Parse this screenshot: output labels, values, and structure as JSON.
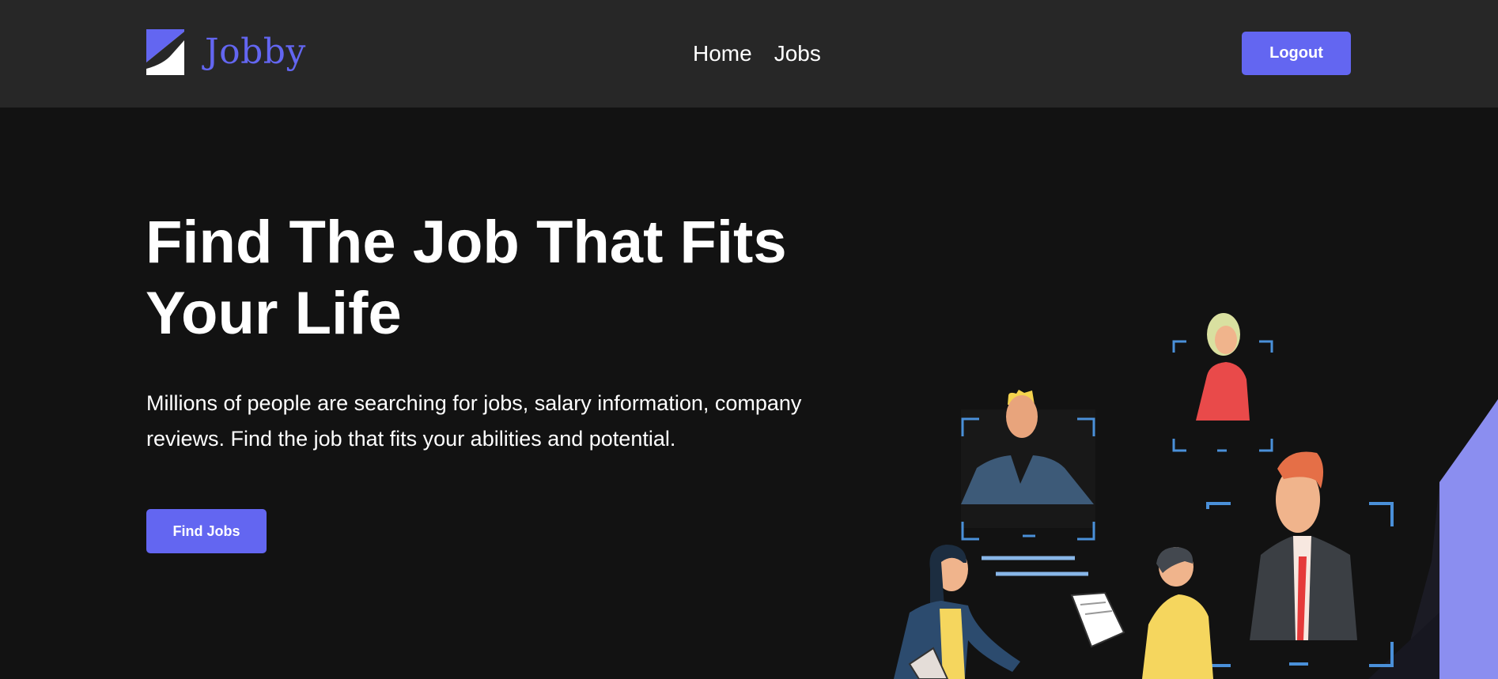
{
  "header": {
    "logo_text": "Jobby",
    "nav": [
      {
        "label": "Home"
      },
      {
        "label": "Jobs"
      }
    ],
    "logout_label": "Logout"
  },
  "hero": {
    "title": "Find The Job That Fits Your Life",
    "description": "Millions of people are searching for jobs, salary information, company reviews. Find the job that fits your abilities and potential.",
    "cta_label": "Find Jobs"
  },
  "colors": {
    "background": "#121212",
    "navbar": "#272727",
    "accent": "#6366f1",
    "text": "#ffffff"
  },
  "icons": {
    "logo": "jobby-logo-icon",
    "illustration": "job-seekers-illustration"
  }
}
